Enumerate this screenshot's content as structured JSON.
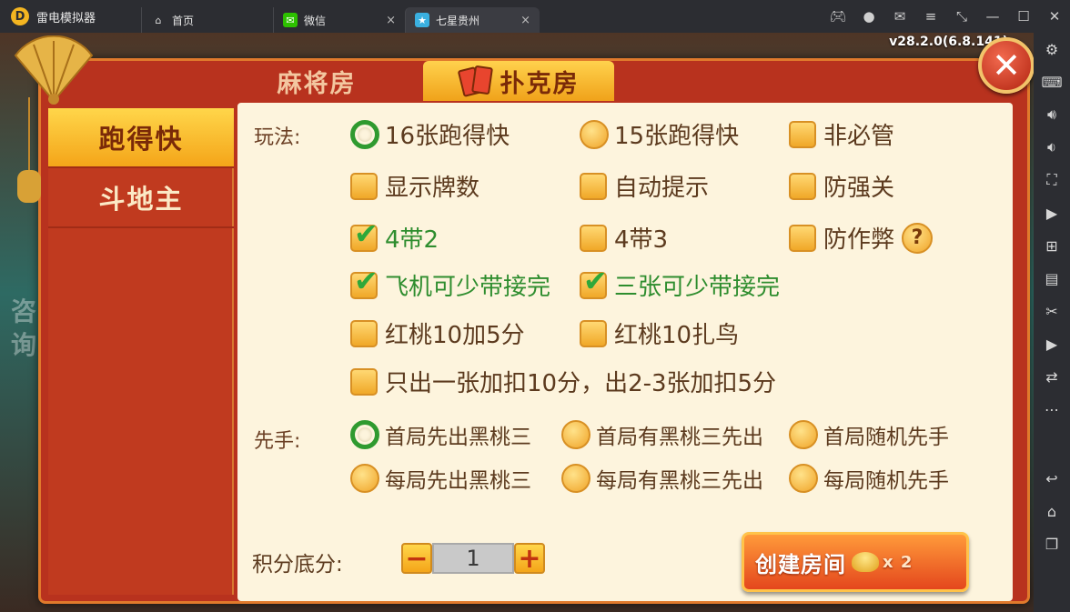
{
  "app": {
    "name": "雷电模拟器",
    "logo_letter": "D"
  },
  "tabs": [
    {
      "label": "首页",
      "icon": "home-icon"
    },
    {
      "label": "微信",
      "icon": "wechat-icon",
      "close": "×"
    },
    {
      "label": "七星贵州",
      "icon": "game-icon",
      "close": "×"
    }
  ],
  "window_controls": [
    "gamepad-icon",
    "account-icon",
    "mail-icon",
    "menu-icon",
    "shrink-icon",
    "minimize-icon",
    "maximize-icon",
    "close-icon"
  ],
  "sidebar_tools": [
    "settings-icon",
    "keyboard-icon",
    "volume-up-icon",
    "volume-down-icon",
    "fullscreen-icon",
    "record-icon",
    "add-icon",
    "apk-icon",
    "scissors-icon",
    "video-icon",
    "sync-icon",
    "more-icon",
    "back-icon",
    "home-icon",
    "recent-icon"
  ],
  "game": {
    "version": "v28.2.0(6.8.141)",
    "bg_text_1": "咨",
    "bg_text_2": "询",
    "room_tabs": {
      "mahjong": "麻将房",
      "poker": "扑克房"
    },
    "close_label": "✕",
    "game_types": [
      "跑得快",
      "斗地主"
    ],
    "play_label": "玩法:",
    "options": {
      "row1": [
        "16张跑得快",
        "15张跑得快",
        "非必管"
      ],
      "row2": [
        "显示牌数",
        "自动提示",
        "防强关"
      ],
      "row3": [
        "4带2",
        "4带3",
        "防作弊"
      ],
      "row4": [
        "飞机可少带接完",
        "三张可少带接完"
      ],
      "row5": [
        "红桃10加5分",
        "红桃10扎鸟"
      ],
      "row6": [
        "只出一张加扣10分，出2-3张加扣5分"
      ]
    },
    "help_label": "?",
    "first_label": "先手:",
    "first_options": {
      "row1": [
        "首局先出黑桃三",
        "首局有黑桃三先出",
        "首局随机先手"
      ],
      "row2": [
        "每局先出黑桃三",
        "每局有黑桃三先出",
        "每局随机先手"
      ]
    },
    "score_label": "积分底分:",
    "score_value": "1",
    "minus": "−",
    "plus": "+",
    "create_label": "创建房间",
    "cost": "x 2"
  },
  "colors": {
    "accent": "#f4a519",
    "dialog": "#b8321e",
    "panel": "#fdf4dd",
    "check": "#2fa83a"
  }
}
